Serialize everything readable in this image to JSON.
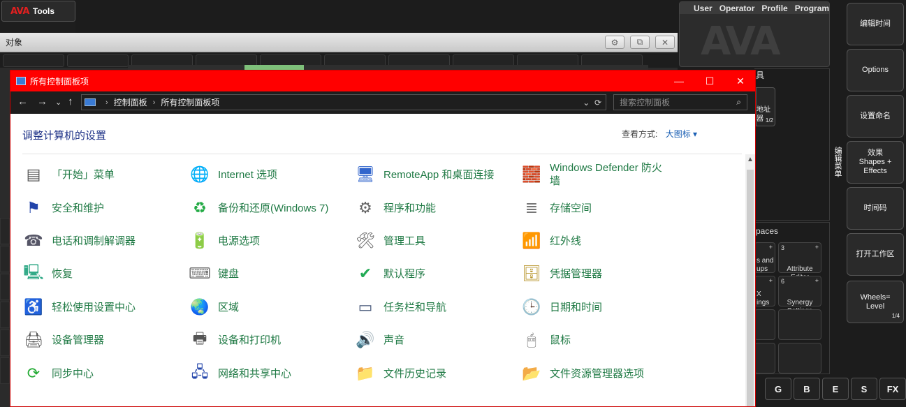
{
  "ava": {
    "logo": "AVA",
    "tools_label": "Tools",
    "bg_window_title": "对象",
    "menu": [
      "User",
      "Operator",
      "Profile",
      "Program"
    ],
    "big_logo": "AVA",
    "mid_header": "具",
    "mid_button": {
      "text": "地址\n器",
      "page": "1/2"
    },
    "vertical_label": "编辑菜单",
    "workspaces_header": "paces",
    "workspaces": [
      {
        "num": "",
        "text": "s and\nups",
        "plus": "+"
      },
      {
        "num": "3",
        "text": "Attribute\nEditor",
        "plus": "+"
      },
      {
        "num": "",
        "text": "X\nings",
        "plus": "+"
      },
      {
        "num": "6",
        "text": "Synergy\nSettings",
        "plus": "+"
      }
    ],
    "side_buttons": [
      {
        "label": "编辑时间",
        "page": ""
      },
      {
        "label": "Options",
        "page": ""
      },
      {
        "label": "设置命名",
        "page": ""
      },
      {
        "label": "效果\nShapes +\nEffects",
        "page": ""
      },
      {
        "label": "时间码",
        "page": ""
      },
      {
        "label": "打开工作区",
        "page": ""
      },
      {
        "label": "Wheels=\nLevel",
        "page": "1/4"
      }
    ],
    "fx_keys": [
      "G",
      "B",
      "E",
      "S",
      "FX"
    ]
  },
  "control_panel": {
    "title": "所有控制面板项",
    "window_controls": {
      "minimize": "—",
      "maximize": "☐",
      "close": "✕"
    },
    "nav": {
      "back": "←",
      "forward": "→",
      "recent": "⌄",
      "up": "↑"
    },
    "breadcrumb": [
      "控制面板",
      "所有控制面板项"
    ],
    "search_placeholder": "搜索控制面板",
    "heading": "调整计算机的设置",
    "view_by_label": "查看方式:",
    "view_by_value": "大图标 ▾",
    "items": [
      {
        "label": "「开始」菜单",
        "icon": "start-menu-icon",
        "glyph": "▤",
        "color": "#555"
      },
      {
        "label": "Internet 选项",
        "icon": "internet-options-icon",
        "glyph": "🌐",
        "color": "#2a7"
      },
      {
        "label": "RemoteApp 和桌面连接",
        "icon": "remoteapp-icon",
        "glyph": "🖥",
        "color": "#36c"
      },
      {
        "label": "Windows Defender 防火墙",
        "icon": "firewall-icon",
        "glyph": "🧱",
        "color": "#a52"
      },
      {
        "label": "安全和维护",
        "icon": "security-flag-icon",
        "glyph": "⚑",
        "color": "#24a"
      },
      {
        "label": "备份和还原(Windows 7)",
        "icon": "backup-icon",
        "glyph": "♻",
        "color": "#2a4"
      },
      {
        "label": "程序和功能",
        "icon": "programs-icon",
        "glyph": "⚙",
        "color": "#666"
      },
      {
        "label": "存储空间",
        "icon": "storage-icon",
        "glyph": "≣",
        "color": "#777"
      },
      {
        "label": "电话和调制解调器",
        "icon": "phone-modem-icon",
        "glyph": "☎",
        "color": "#556"
      },
      {
        "label": "电源选项",
        "icon": "power-options-icon",
        "glyph": "🔋",
        "color": "#4a4"
      },
      {
        "label": "管理工具",
        "icon": "admin-tools-icon",
        "glyph": "🛠",
        "color": "#666"
      },
      {
        "label": "红外线",
        "icon": "infrared-icon",
        "glyph": "📶",
        "color": "#c33"
      },
      {
        "label": "恢复",
        "icon": "recovery-icon",
        "glyph": "🖳",
        "color": "#3a8"
      },
      {
        "label": "键盘",
        "icon": "keyboard-icon",
        "glyph": "⌨",
        "color": "#777"
      },
      {
        "label": "默认程序",
        "icon": "default-programs-icon",
        "glyph": "✔",
        "color": "#2a5"
      },
      {
        "label": "凭据管理器",
        "icon": "credential-manager-icon",
        "glyph": "🗄",
        "color": "#b93"
      },
      {
        "label": "轻松使用设置中心",
        "icon": "ease-of-access-icon",
        "glyph": "♿",
        "color": "#24a"
      },
      {
        "label": "区域",
        "icon": "region-icon",
        "glyph": "🌏",
        "color": "#37a"
      },
      {
        "label": "任务栏和导航",
        "icon": "taskbar-icon",
        "glyph": "▭",
        "color": "#457"
      },
      {
        "label": "日期和时间",
        "icon": "date-time-icon",
        "glyph": "🕒",
        "color": "#48a"
      },
      {
        "label": "设备管理器",
        "icon": "device-manager-icon",
        "glyph": "🖨",
        "color": "#555"
      },
      {
        "label": "设备和打印机",
        "icon": "devices-printers-icon",
        "glyph": "🖶",
        "color": "#555"
      },
      {
        "label": "声音",
        "icon": "sound-icon",
        "glyph": "🔊",
        "color": "#777"
      },
      {
        "label": "鼠标",
        "icon": "mouse-icon",
        "glyph": "🖱",
        "color": "#666"
      },
      {
        "label": "同步中心",
        "icon": "sync-center-icon",
        "glyph": "⟳",
        "color": "#2a3"
      },
      {
        "label": "网络和共享中心",
        "icon": "network-sharing-icon",
        "glyph": "🖧",
        "color": "#24a"
      },
      {
        "label": "文件历史记录",
        "icon": "file-history-icon",
        "glyph": "📁",
        "color": "#c93"
      },
      {
        "label": "文件资源管理器选项",
        "icon": "file-explorer-options-icon",
        "glyph": "📂",
        "color": "#cb5"
      }
    ]
  }
}
